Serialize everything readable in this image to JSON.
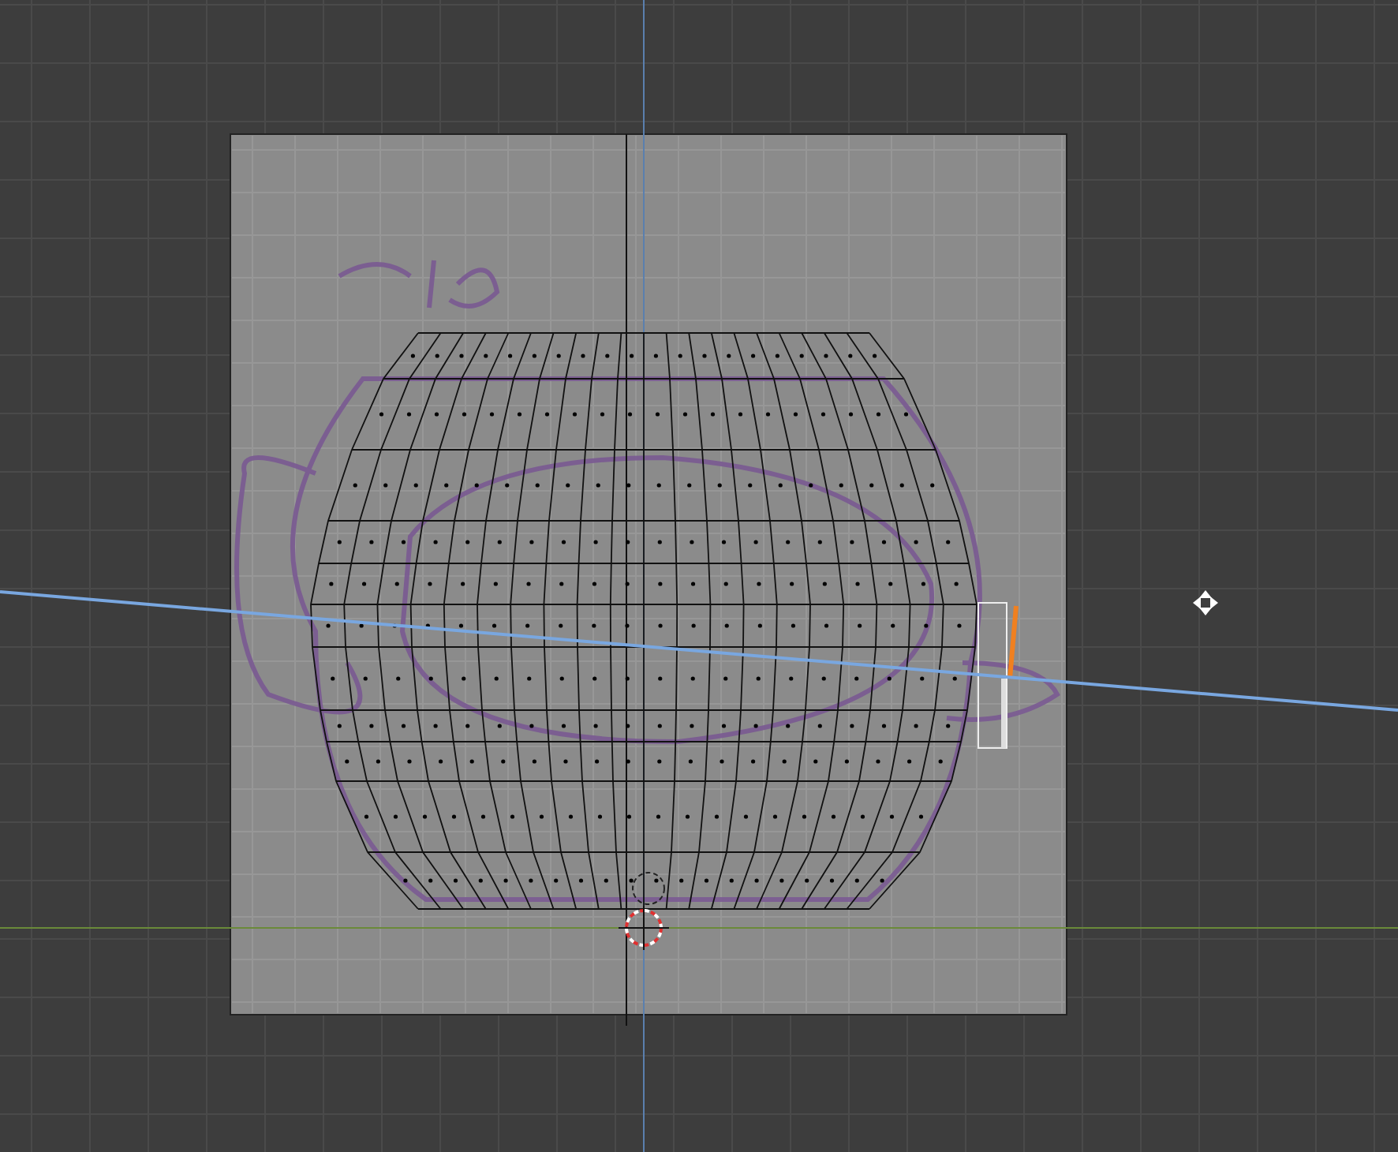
{
  "viewport": {
    "reference_image_visible": true,
    "mesh_visible": true,
    "cursor_3d_visible": true
  }
}
